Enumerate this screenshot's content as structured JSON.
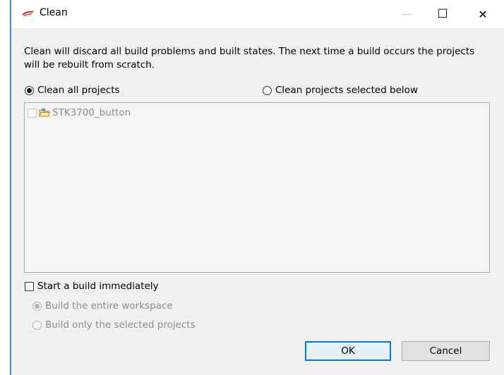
{
  "window": {
    "title": "Clean",
    "minimize_glyph": "—",
    "maximize_glyph": "☐",
    "close_glyph": "✕",
    "icon": "eclipse-logo-icon"
  },
  "description": "Clean will discard all build problems and built states.  The next time a build occurs the projects will be rebuilt from scratch.",
  "scope": {
    "clean_all_label": "Clean all projects",
    "clean_selected_label": "Clean projects selected below",
    "selected": "clean_all"
  },
  "projects": [
    {
      "name": "STK3700_button",
      "checked": false,
      "icon": "open-project-folder-icon"
    }
  ],
  "build": {
    "start_build_label": "Start a build immediately",
    "start_build_checked": false,
    "entire_workspace_label": "Build the entire workspace",
    "selected_projects_label": "Build only the selected projects",
    "selected": "entire_workspace"
  },
  "buttons": {
    "ok_label": "OK",
    "cancel_label": "Cancel"
  },
  "colors": {
    "accent": "#0078d7",
    "left_border": "#4a88c8",
    "dialog_bg": "#f0f0f0"
  }
}
